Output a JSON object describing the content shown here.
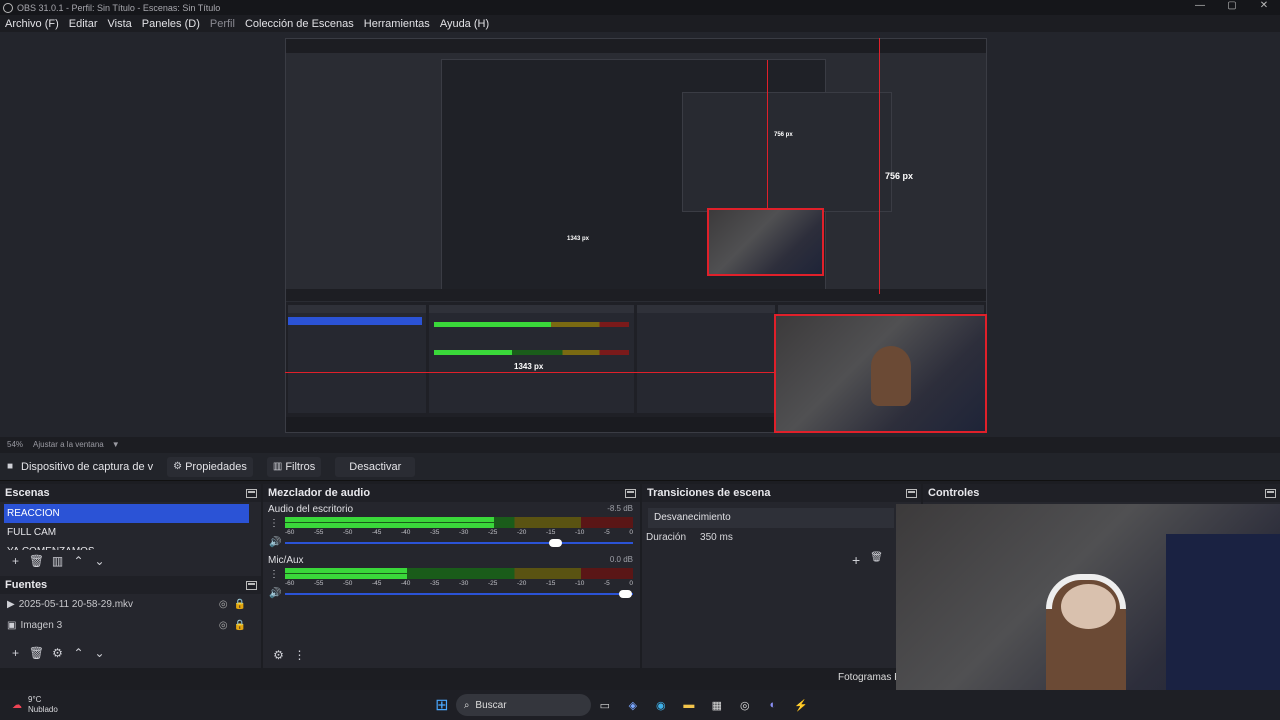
{
  "window": {
    "title": "OBS 31.0.1 - Perfil: Sin Título - Escenas: Sin Título",
    "min": "—",
    "max": "▢",
    "close": "✕"
  },
  "menu": [
    {
      "label": "Archivo (F)"
    },
    {
      "label": "Editar"
    },
    {
      "label": "Vista"
    },
    {
      "label": "Paneles (D)"
    },
    {
      "label": "Perfil",
      "dim": true
    },
    {
      "label": "Colección de Escenas"
    },
    {
      "label": "Herramientas"
    },
    {
      "label": "Ayuda (H)"
    }
  ],
  "preview": {
    "label_vertical": "756 px",
    "label_horizontal": "1343 px",
    "nested_label_vertical": "756 px",
    "nested_label_horizontal": "1343 px"
  },
  "status": {
    "zoom": "54%",
    "fit": "Ajustar a la ventana"
  },
  "toolbar": {
    "source": "Dispositivo de captura de v",
    "properties": "Propiedades",
    "filters": "Filtros",
    "deactivate": "Desactivar"
  },
  "scenes": {
    "title": "Escenas",
    "items": [
      "REACCION",
      "FULL CAM",
      "YA COMENZAMOS"
    ],
    "selected": 0
  },
  "sources": {
    "title": "Fuentes",
    "items": [
      "2025-05-11 20-58-29.mkv",
      "Imagen 3"
    ]
  },
  "mixer": {
    "title": "Mezclador de audio",
    "channels": [
      {
        "name": "Audio del escritorio",
        "db": "-8.5 dB",
        "level": 0.6,
        "level2": 0.6,
        "volume": 0.78
      },
      {
        "name": "Mic/Aux",
        "db": "0.0 dB",
        "level": 0.35,
        "level2": 0.35,
        "volume": 0.98
      }
    ],
    "scale": [
      "-60",
      "-55",
      "-50",
      "-45",
      "-40",
      "-35",
      "-30",
      "-25",
      "-20",
      "-15",
      "-10",
      "-5",
      "0"
    ]
  },
  "transitions": {
    "title": "Transiciones de escena",
    "current": "Desvanecimiento",
    "duration_label": "Duración",
    "duration_value": "350 ms"
  },
  "controls": {
    "title": "Controles",
    "fps": "Fotogramas P"
  },
  "taskbar": {
    "weather_temp": "9°C",
    "weather_desc": "Nublado",
    "search": "Buscar"
  },
  "colors": {
    "accent": "#2b53d6",
    "red": "#e0202a",
    "green": "#3ad83a"
  }
}
